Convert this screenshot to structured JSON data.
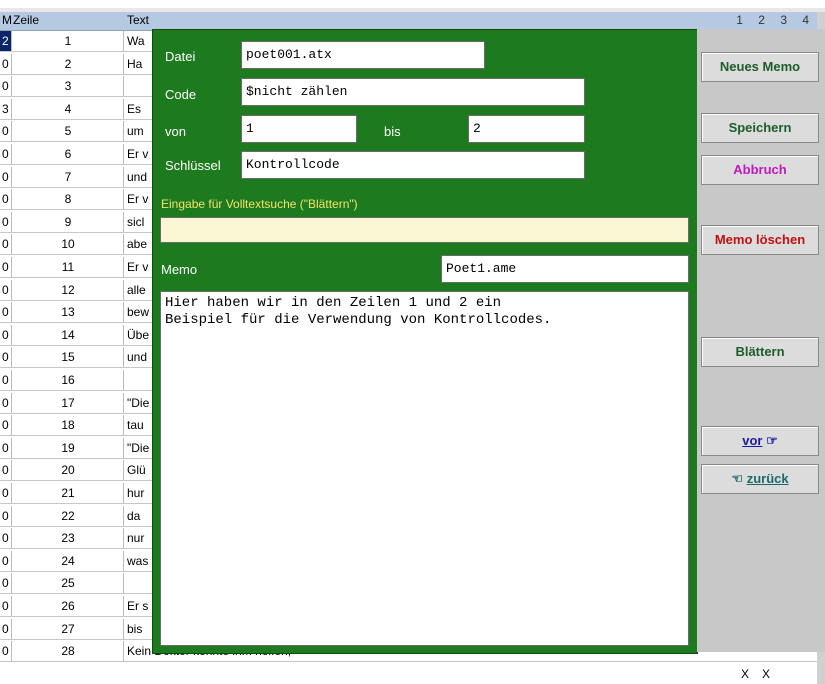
{
  "table": {
    "headers": {
      "m": "M",
      "zeile": "Zeile",
      "text": "Text"
    },
    "pages": "1 2 3 4",
    "rows": [
      {
        "m": "2",
        "z": "1",
        "t": "Wa"
      },
      {
        "m": "0",
        "z": "2",
        "t": "Ha"
      },
      {
        "m": "0",
        "z": "3",
        "t": ""
      },
      {
        "m": "3",
        "z": "4",
        "t": "Es"
      },
      {
        "m": "0",
        "z": "5",
        "t": "um"
      },
      {
        "m": "0",
        "z": "6",
        "t": "Er v"
      },
      {
        "m": "0",
        "z": "7",
        "t": "und"
      },
      {
        "m": "0",
        "z": "8",
        "t": "Er v"
      },
      {
        "m": "0",
        "z": "9",
        "t": "sicl"
      },
      {
        "m": "0",
        "z": "10",
        "t": "abe"
      },
      {
        "m": "0",
        "z": "11",
        "t": "Er v"
      },
      {
        "m": "0",
        "z": "12",
        "t": "alle"
      },
      {
        "m": "0",
        "z": "13",
        "t": "bew"
      },
      {
        "m": "0",
        "z": "14",
        "t": "Übe"
      },
      {
        "m": "0",
        "z": "15",
        "t": "und"
      },
      {
        "m": "0",
        "z": "16",
        "t": ""
      },
      {
        "m": "0",
        "z": "17",
        "t": "\"Die"
      },
      {
        "m": "0",
        "z": "18",
        "t": "tau"
      },
      {
        "m": "0",
        "z": "19",
        "t": "\"Die"
      },
      {
        "m": "0",
        "z": "20",
        "t": "Glü"
      },
      {
        "m": "0",
        "z": "21",
        "t": "hur"
      },
      {
        "m": "0",
        "z": "22",
        "t": "da"
      },
      {
        "m": "0",
        "z": "23",
        "t": "nur"
      },
      {
        "m": "0",
        "z": "24",
        "t": "was"
      },
      {
        "m": "0",
        "z": "25",
        "t": ""
      },
      {
        "m": "0",
        "z": "26",
        "t": "Er s"
      },
      {
        "m": "0",
        "z": "27",
        "t": "bis"
      },
      {
        "m": "0",
        "z": "28",
        "t": "Kein Doktor konnte ihm helfen,"
      }
    ],
    "last_row_marks": [
      "X",
      "X"
    ]
  },
  "dialog": {
    "datei_label": "Datei",
    "datei_value": "poet001.atx",
    "code_label": "Code",
    "code_value": "$nicht zählen",
    "von_label": "von",
    "von_value": "1",
    "bis_label": "bis",
    "bis_value": "2",
    "schluessel_label": "Schlüssel",
    "schluessel_value": "Kontrollcode",
    "search_label": "Eingabe für Volltextsuche (\"Blättern\")",
    "search_value": "",
    "memo_label": "Memo",
    "memo_file": "Poet1.ame",
    "memo_text": "Hier haben wir in den Zeilen 1 und 2 ein\nBeispiel für die Verwendung von Kontrollcodes."
  },
  "buttons": {
    "neues_memo": "Neues Memo",
    "speichern": "Speichern",
    "abbruch": "Abbruch",
    "memo_loeschen": "Memo löschen",
    "blaettern": "Blättern",
    "vor": "vor",
    "zurueck": "zurück"
  },
  "colors": {
    "dialog_bg": "#1e7a1e",
    "panel_bg": "#c8c8c8",
    "search_bg": "#fbf7d4"
  }
}
